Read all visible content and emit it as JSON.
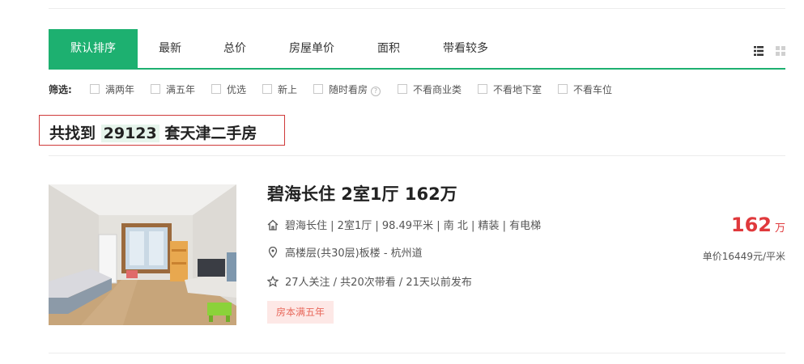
{
  "sort_tabs": [
    {
      "label": "默认排序",
      "active": true
    },
    {
      "label": "最新"
    },
    {
      "label": "总价"
    },
    {
      "label": "房屋单价"
    },
    {
      "label": "面积"
    },
    {
      "label": "带看较多"
    }
  ],
  "filters": {
    "label": "筛选:",
    "options": [
      "满两年",
      "满五年",
      "优选",
      "新上",
      "随时看房",
      "不看商业类",
      "不看地下室",
      "不看车位"
    ]
  },
  "result": {
    "prefix": "共找到",
    "count": "29123",
    "suffix": "套天津二手房"
  },
  "listing": {
    "title": "碧海长住 2室1厅 162万",
    "community": "碧海长住",
    "details": "| 2室1厅 | 98.49平米 | 南 北 | 精装 | 有电梯",
    "location": "高楼层(共30层)板楼 - 杭州道",
    "follow": "27人关注 / 共20次带看 / 21天以前发布",
    "tag": "房本满五年",
    "total_price": "162",
    "price_unit": "万",
    "unit_price": "单价16449元/平米"
  },
  "colors": {
    "accent": "#1db070",
    "price": "#e0393c",
    "highlight": "#cf3a3a"
  },
  "icons": [
    "list-view-icon",
    "grid-view-icon",
    "house-icon",
    "location-pin-icon",
    "star-icon",
    "help-icon"
  ]
}
